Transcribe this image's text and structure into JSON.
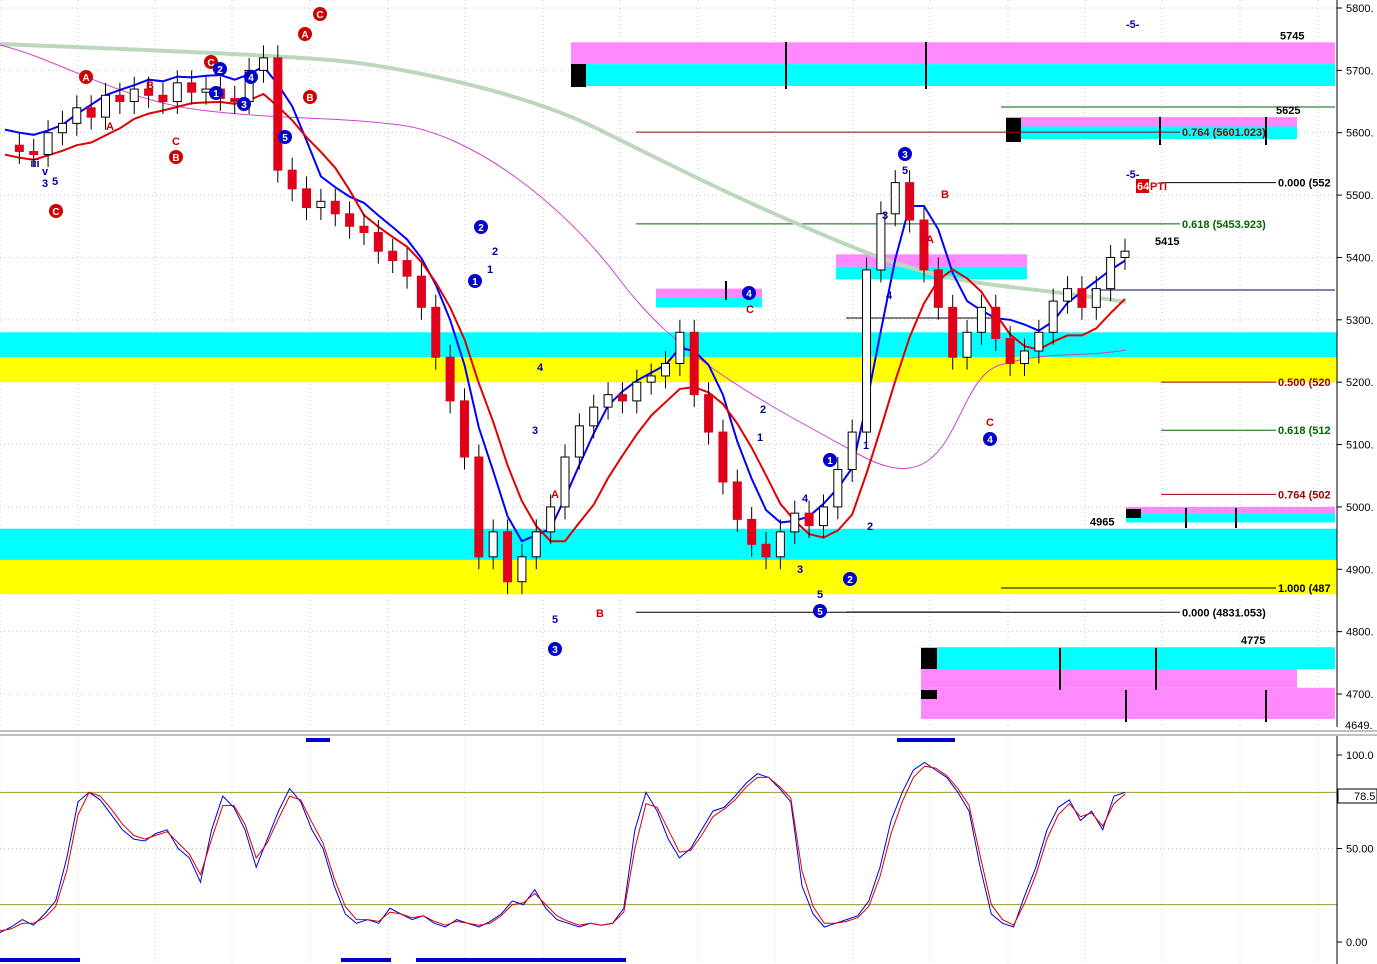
{
  "colors": {
    "background": "#ffffff",
    "grid": "#c8c8c8",
    "candle_up": "#ffffff",
    "candle_down": "#e0001a",
    "candle_body_black": "#000000",
    "blue_band": "#0000ff",
    "red_band": "#e00000",
    "ma_green": "#bcd8bc",
    "ma_magenta": "#cc44cc",
    "zone_cyan": "#00ffff",
    "zone_yellow": "#ffff00",
    "zone_pink": "#ff88ff",
    "fib_red": "#990000",
    "fib_green": "#006600",
    "stoch_k": "#0000dd",
    "stoch_d": "#dd0000",
    "stoch_level": "#999933"
  },
  "chart_data": [
    {
      "type": "line",
      "panel": "price",
      "grid": true,
      "ylim": [
        4649,
        5800
      ],
      "y_ticks": [
        5800,
        5700,
        5600,
        5500,
        5400,
        5300,
        5200,
        5100,
        5000,
        4900,
        4800,
        4700
      ],
      "y_tick_labels": [
        "5800.",
        "5700.",
        "5600.",
        "5500.",
        "5400.",
        "5300.",
        "5200.",
        "5100.",
        "5000.",
        "4900.",
        "4800.",
        "4700."
      ],
      "y_min_label": "4649.",
      "close_path": [
        5580,
        5570,
        5565,
        5600,
        5615,
        5640,
        5625,
        5660,
        5650,
        5670,
        5660,
        5650,
        5680,
        5665,
        5670,
        5655,
        5650,
        5700,
        5720,
        5540,
        5510,
        5480,
        5490,
        5470,
        5450,
        5440,
        5410,
        5395,
        5370,
        5320,
        5240,
        5170,
        5080,
        4920,
        4960,
        4880,
        4920,
        4960,
        5000,
        5080,
        5130,
        5160,
        5180,
        5170,
        5200,
        5210,
        5230,
        5280,
        5180,
        5120,
        5040,
        4980,
        4940,
        4920,
        4960,
        4990,
        4970,
        5000,
        5060,
        5120,
        5380,
        5470,
        5520,
        5460,
        5380,
        5320,
        5240,
        5280,
        5320,
        5270,
        5230,
        5250,
        5280,
        5330,
        5350,
        5320,
        5350,
        5400,
        5410
      ],
      "zones": [
        {
          "y_from": 5710,
          "y_to": 5745,
          "color": "pink"
        },
        {
          "y_from": 5675,
          "y_to": 5710,
          "color": "cyan"
        },
        {
          "y_from": 5610,
          "y_to": 5625,
          "color": "pink"
        },
        {
          "y_from": 5590,
          "y_to": 5610,
          "color": "cyan"
        },
        {
          "y_from": 5385,
          "y_to": 5405,
          "color": "pink"
        },
        {
          "y_from": 5365,
          "y_to": 5385,
          "color": "cyan"
        },
        {
          "y_from": 5335,
          "y_to": 5350,
          "color": "pink"
        },
        {
          "y_from": 5320,
          "y_to": 5335,
          "color": "cyan"
        },
        {
          "y_from": 5240,
          "y_to": 5280,
          "color": "cyan"
        },
        {
          "y_from": 5200,
          "y_to": 5240,
          "color": "yellow"
        },
        {
          "y_from": 4990,
          "y_to": 5000,
          "color": "pink"
        },
        {
          "y_from": 4975,
          "y_to": 4990,
          "color": "cyan"
        },
        {
          "y_from": 4915,
          "y_to": 4965,
          "color": "cyan"
        },
        {
          "y_from": 4860,
          "y_to": 4915,
          "color": "yellow"
        },
        {
          "y_from": 4740,
          "y_to": 4775,
          "color": "cyan"
        },
        {
          "y_from": 4710,
          "y_to": 4740,
          "color": "pink"
        },
        {
          "y_from": 4660,
          "y_to": 4710,
          "color": "pink"
        }
      ],
      "price_labels": [
        {
          "text": "5745",
          "y": 5745
        },
        {
          "text": "5625",
          "y": 5625
        },
        {
          "text": "5415",
          "y": 5415
        },
        {
          "text": "4965",
          "y": 4965
        },
        {
          "text": "4775",
          "y": 4775
        }
      ],
      "fib_levels": [
        {
          "text": "0.764 (5601.023)",
          "y": 5601.023,
          "color": "red"
        },
        {
          "text": "0.000 (552",
          "y": 5520,
          "color": "black"
        },
        {
          "text": "0.618 (5453.923)",
          "y": 5453.923,
          "color": "green"
        },
        {
          "text": "0.500 (520",
          "y": 5200,
          "color": "red"
        },
        {
          "text": "0.618 (512",
          "y": 5123,
          "color": "green"
        },
        {
          "text": "0.764 (502",
          "y": 5020,
          "color": "red"
        },
        {
          "text": "1.000 (487",
          "y": 4870,
          "color": "black"
        },
        {
          "text": "0.000 (4831.053)",
          "y": 4831.053,
          "color": "black"
        }
      ],
      "top_annotations": [
        "-5-",
        "-5-",
        "64",
        "PTI"
      ]
    },
    {
      "type": "line",
      "panel": "stochastic",
      "ylim": [
        0,
        100
      ],
      "y_ticks": [
        100,
        50,
        0
      ],
      "y_tick_labels": [
        "100.0",
        "50.00",
        "0.00"
      ],
      "current_value_label": "78.5",
      "levels": [
        80,
        20
      ],
      "series": [
        {
          "values": [
            5,
            8,
            12,
            9,
            15,
            22,
            45,
            75,
            80,
            76,
            68,
            60,
            55,
            54,
            58,
            60,
            50,
            45,
            32,
            60,
            78,
            72,
            60,
            40,
            55,
            70,
            82,
            75,
            60,
            50,
            30,
            15,
            10,
            12,
            10,
            18,
            15,
            12,
            14,
            10,
            8,
            12,
            10,
            8,
            11,
            15,
            22,
            20,
            28,
            18,
            12,
            10,
            8,
            10,
            9,
            10,
            18,
            60,
            80,
            70,
            55,
            45,
            50,
            60,
            70,
            72,
            78,
            85,
            90,
            88,
            82,
            75,
            30,
            15,
            8,
            10,
            12,
            14,
            22,
            40,
            65,
            80,
            92,
            96,
            92,
            88,
            80,
            70,
            40,
            15,
            10,
            8,
            25,
            40,
            60,
            72,
            76,
            65,
            70,
            60,
            78,
            80
          ]
        },
        {
          "values": [
            6,
            7,
            10,
            10,
            13,
            19,
            38,
            68,
            80,
            78,
            71,
            63,
            57,
            55,
            57,
            59,
            53,
            47,
            36,
            55,
            73,
            73,
            63,
            45,
            53,
            66,
            78,
            76,
            64,
            53,
            34,
            19,
            12,
            12,
            11,
            16,
            15,
            13,
            14,
            11,
            9,
            11,
            10,
            9,
            10,
            14,
            20,
            21,
            26,
            20,
            14,
            11,
            9,
            10,
            9,
            10,
            16,
            50,
            74,
            72,
            60,
            48,
            49,
            57,
            67,
            71,
            76,
            83,
            88,
            88,
            83,
            77,
            38,
            19,
            10,
            10,
            11,
            13,
            19,
            35,
            58,
            75,
            88,
            94,
            93,
            89,
            82,
            73,
            46,
            20,
            12,
            9,
            21,
            36,
            55,
            68,
            74,
            67,
            69,
            62,
            74,
            79
          ]
        }
      ]
    }
  ]
}
